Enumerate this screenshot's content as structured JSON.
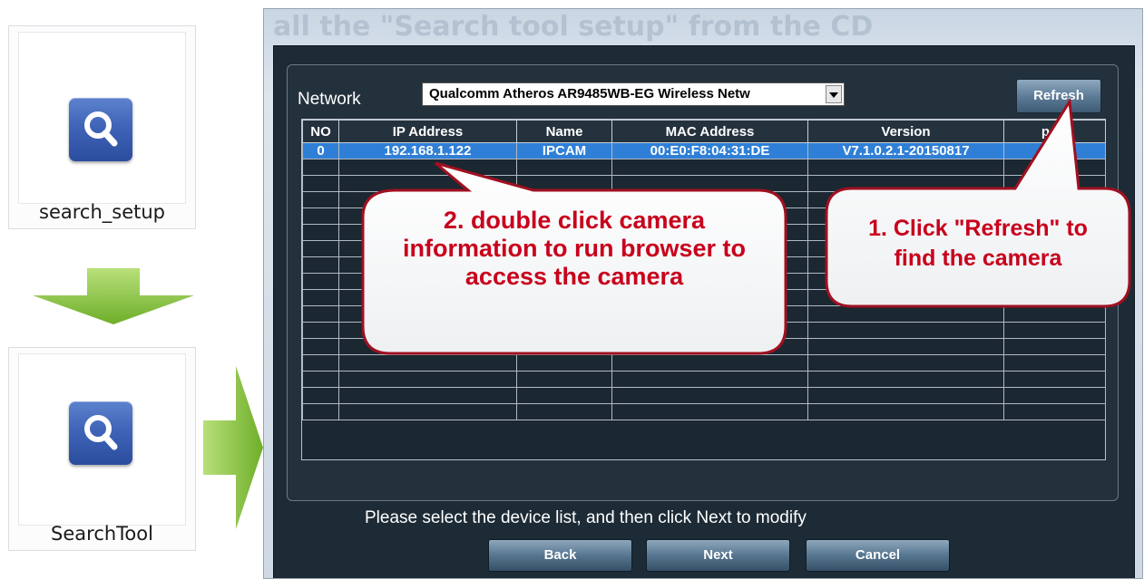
{
  "left_panel": {
    "setup_icon_label": "search_setup",
    "tool_icon_label": "SearchTool"
  },
  "window": {
    "faded_title": "all the \"Search tool setup\" from the CD",
    "network_label": "Network",
    "network_selected": "Qualcomm Atheros AR9485WB-EG Wireless Netw",
    "refresh_label": "Refresh",
    "hint_text": "Please select the device list, and then click Next to modify",
    "back_label": "Back",
    "next_label": "Next",
    "cancel_label": "Cancel"
  },
  "table": {
    "columns": [
      "NO",
      "IP Address",
      "Name",
      "MAC Address",
      "Version",
      "port"
    ],
    "rows": [
      {
        "no": "0",
        "ip": "192.168.1.122",
        "name": "IPCAM",
        "mac": "00:E0:F8:04:31:DE",
        "version": "V7.1.0.2.1-20150817",
        "port": ""
      }
    ]
  },
  "callouts": {
    "refresh_line1": "1. Click \"Refresh\" to",
    "refresh_line2": "find the camera",
    "double_line1": "2. double click camera",
    "double_line2": "information to run browser to",
    "double_line3": "access the camera"
  },
  "colors": {
    "callout_text": "#c8001c",
    "dialog_bg": "#1d2b36",
    "selected_row": "#2f7fd6",
    "arrow_green": "#8cc63f",
    "icon_blue": "#3f64b8"
  }
}
